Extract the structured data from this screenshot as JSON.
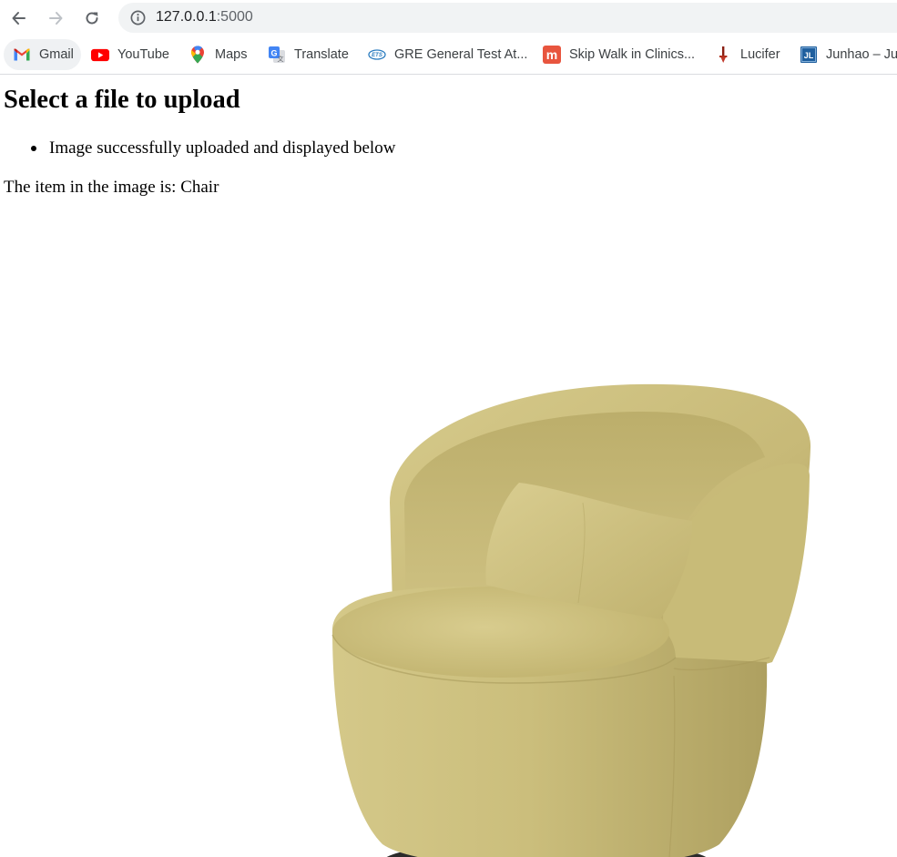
{
  "browser": {
    "address": {
      "host": "127.0.0.1",
      "port": ":5000"
    },
    "bookmarks": [
      {
        "label": "Gmail",
        "icon": "gmail-icon"
      },
      {
        "label": "YouTube",
        "icon": "youtube-icon"
      },
      {
        "label": "Maps",
        "icon": "maps-icon"
      },
      {
        "label": "Translate",
        "icon": "translate-icon"
      },
      {
        "label": "GRE General Test At...",
        "icon": "ets-icon"
      },
      {
        "label": "Skip Walk in Clinics...",
        "icon": "m-icon"
      },
      {
        "label": "Lucifer",
        "icon": "lucifer-icon"
      },
      {
        "label": "Junhao – Ju",
        "icon": "jl-icon",
        "icon_text": "JL"
      }
    ]
  },
  "page": {
    "title": "Select a file to upload",
    "messages": [
      "Image successfully uploaded and displayed below"
    ],
    "result_prefix": "The item in the image is:",
    "result_value": "Chair",
    "image": {
      "subject": "chair",
      "fabric_color": "#c9bd7a",
      "base_color": "#1e1e1e"
    }
  }
}
